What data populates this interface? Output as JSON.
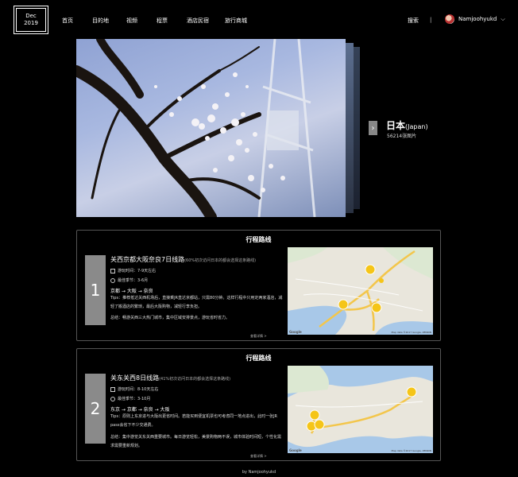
{
  "logo": {
    "line1": "Dec",
    "line2": "2019"
  },
  "nav": [
    "首页",
    "目的地",
    "视频",
    "程票",
    "酒店民宿",
    "旅行商城"
  ],
  "header": {
    "search_label": "搜索",
    "divider": "|",
    "username": "Namjoohyukd",
    "chevron": "⌵"
  },
  "hero": {
    "country": "日本",
    "country_en": "(Japan)",
    "photo_count": "56214张图片",
    "next_arrow": "›"
  },
  "routes": [
    {
      "section_title": "行程路线",
      "number": "1",
      "name": "关西京都大阪奈良7日线路",
      "note": "(60%初次访问日本的都会选择这条路线)",
      "days": "游玩时间：7-9天左右",
      "season": "最佳季节：3-6月",
      "path": "京都 → 大阪 → 奈良",
      "tips": "Tips：推荐抵达关西机场后，直接乘JR直达京都站，只需80分钟。这样行程中只用定两家酒店，减轻了搬酒店的繁琐，最后大阪购物，减轻行李负担。",
      "summary": "总结：畅游关西三大热门城市，集中区域安排景点，游玩省时省力。",
      "more": "查看详情 >"
    },
    {
      "section_title": "行程路线",
      "number": "2",
      "name": "关东关西8日线路",
      "note": "(41%初次访问日本的都会选择这条路线)",
      "days": "游玩时间：8-10天左右",
      "season": "最佳季节：3-10月",
      "path": "东京 → 京都 → 奈良 → 大阪",
      "tips": "Tips：原则上东京进与大阪出更省时间。若能买到便宜机票也可考虑同一地点进出，此时一张JR pass会省下不少交通费。",
      "summary": "总结：集中游览关东关西重要城市。每日游览轻松，美景购物两不误，城市体验时间短，个性化需求需要重新规划。",
      "more": "查看详情 >"
    }
  ],
  "map": {
    "credit": "Map data ©2017 Google, ZENRIN",
    "brand": "Google"
  },
  "footer": "by Namjoohyukd"
}
